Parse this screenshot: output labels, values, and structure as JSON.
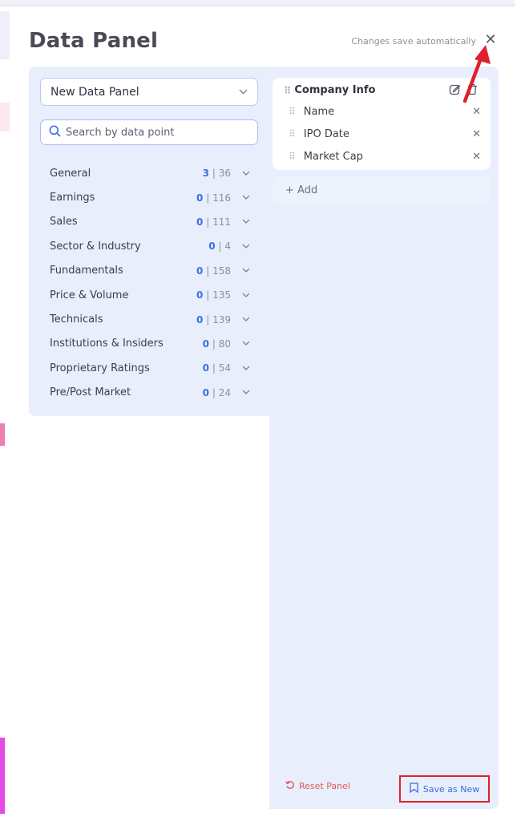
{
  "header": {
    "title": "Data Panel",
    "autosave_text": "Changes save automatically",
    "close_glyph": "✕"
  },
  "panel_select": {
    "value": "New Data Panel"
  },
  "search": {
    "placeholder": "Search by data point"
  },
  "categories": [
    {
      "label": "General",
      "selected": "3",
      "total": "36"
    },
    {
      "label": "Earnings",
      "selected": "0",
      "total": "116"
    },
    {
      "label": "Sales",
      "selected": "0",
      "total": "111"
    },
    {
      "label": "Sector & Industry",
      "selected": "0",
      "total": "4"
    },
    {
      "label": "Fundamentals",
      "selected": "0",
      "total": "158"
    },
    {
      "label": "Price & Volume",
      "selected": "0",
      "total": "135"
    },
    {
      "label": "Technicals",
      "selected": "0",
      "total": "139"
    },
    {
      "label": "Institutions & Insiders",
      "selected": "0",
      "total": "80"
    },
    {
      "label": "Proprietary Ratings",
      "selected": "0",
      "total": "54"
    },
    {
      "label": "Pre/Post Market",
      "selected": "0",
      "total": "24"
    }
  ],
  "count_separator": "|",
  "group": {
    "title": "Company Info",
    "fields": [
      {
        "label": "Name"
      },
      {
        "label": "IPO Date"
      },
      {
        "label": "Market Cap"
      }
    ],
    "remove_glyph": "✕"
  },
  "add_label": "+ Add",
  "footer": {
    "reset_label": "Reset Panel",
    "save_label": "Save as New"
  },
  "colors": {
    "accent_blue": "#3c6fe0",
    "reset_red": "#e05a5a",
    "highlight_red": "#e0202e",
    "panel_bg": "#e8eefc"
  },
  "icons": [
    "search-icon",
    "chevron-down-icon",
    "drag-handle-icon",
    "edit-icon",
    "delete-icon",
    "close-icon",
    "reset-icon",
    "bookmark-icon"
  ]
}
